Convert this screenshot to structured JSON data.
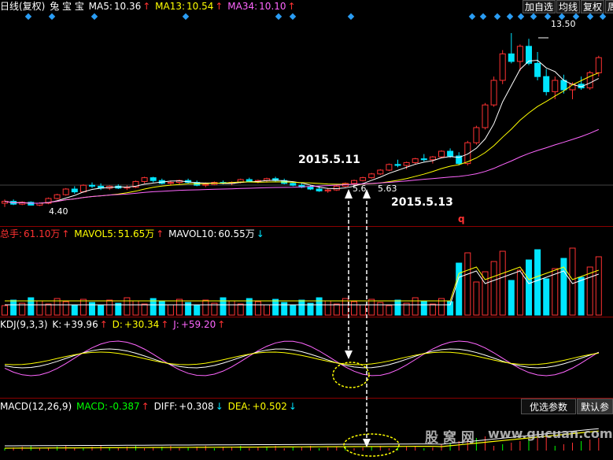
{
  "header": {
    "title": "日线(复权)",
    "stock_name": "兔 宝 宝",
    "ma5_label": "MA5:",
    "ma5_value": "10.36",
    "ma5_arrow": "↑",
    "ma13_label": "MA13:",
    "ma13_value": "10.54",
    "ma13_arrow": "↑",
    "ma34_label": "MA34:",
    "ma34_value": "10.10",
    "ma34_arrow": "↑"
  },
  "toolbar": {
    "add_watch": "加自选",
    "ma_line": "均线",
    "adjust": "复权",
    "more": "周"
  },
  "volume_header": {
    "total_label": "总手:",
    "total_value": "61.10万",
    "total_arrow": "↑",
    "mavol5_label": "MAVOL5:",
    "mavol5_value": "51.65万",
    "mavol5_arrow": "↑",
    "mavol10_label": "MAVOL10:",
    "mavol10_value": "60.55万",
    "mavol10_arrow": "↓"
  },
  "kdj_header": {
    "name": "KDJ(9,3,3)",
    "k_label": "K:",
    "k_value": "+39.96",
    "k_arrow": "↑",
    "d_label": "D:",
    "d_value": "+30.34",
    "d_arrow": "↑",
    "j_label": "J:",
    "j_value": "+59.20",
    "j_arrow": "↑"
  },
  "macd_header": {
    "name": "MACD(12,26,9)",
    "macd_label": "MACD:",
    "macd_value": "-0.387",
    "macd_arrow": "↑",
    "diff_label": "DIFF:",
    "diff_value": "+0.308",
    "diff_arrow": "↓",
    "dea_label": "DEA:",
    "dea_value": "+0.502",
    "dea_arrow": "↓"
  },
  "tabs": {
    "optimized": "优选参数",
    "default": "默认参"
  },
  "annotations": {
    "date1": "2015.5.11",
    "date2": "2015.5.13",
    "marker_q": "q"
  },
  "price_labels": {
    "high": "13.50",
    "low": "4.40",
    "mid1": "5.6",
    "mid2": "5.63"
  },
  "watermark": {
    "cn": "股 窝 网",
    "url": "www.gucuan.com"
  },
  "colors": {
    "up": "#ff3232",
    "down": "#00e5ff",
    "ma5": "#ffffff",
    "ma13": "#ffff00",
    "ma34": "#ff66ff",
    "grid": "#8b0000",
    "diamond": "#2a9df4",
    "k": "#ffffff",
    "d": "#ffff00",
    "j": "#ff66ff",
    "dashed_circle": "#ffff00"
  },
  "chart_data": {
    "type": "candlestick",
    "ylim": [
      4,
      14
    ],
    "series": [
      {
        "name": "MA5",
        "value": 10.36
      },
      {
        "name": "MA13",
        "value": 10.54
      },
      {
        "name": "MA34",
        "value": 10.1
      }
    ],
    "candles": [
      [
        4.5,
        4.7,
        4.3,
        4.6
      ],
      [
        4.6,
        4.7,
        4.4,
        4.45
      ],
      [
        4.45,
        4.6,
        4.4,
        4.55
      ],
      [
        4.55,
        4.6,
        4.38,
        4.4
      ],
      [
        4.4,
        4.55,
        4.35,
        4.5
      ],
      [
        4.5,
        4.8,
        4.45,
        4.75
      ],
      [
        4.75,
        5.0,
        4.7,
        4.95
      ],
      [
        4.95,
        5.3,
        4.9,
        5.25
      ],
      [
        5.25,
        5.4,
        5.0,
        5.1
      ],
      [
        5.1,
        5.5,
        5.05,
        5.45
      ],
      [
        5.45,
        5.6,
        5.3,
        5.4
      ],
      [
        5.4,
        5.55,
        5.2,
        5.3
      ],
      [
        5.3,
        5.45,
        5.2,
        5.4
      ],
      [
        5.4,
        5.5,
        5.25,
        5.3
      ],
      [
        5.3,
        5.45,
        5.2,
        5.35
      ],
      [
        5.35,
        5.7,
        5.3,
        5.65
      ],
      [
        5.65,
        5.9,
        5.55,
        5.85
      ],
      [
        5.85,
        5.9,
        5.6,
        5.7
      ],
      [
        5.7,
        5.8,
        5.5,
        5.55
      ],
      [
        5.55,
        5.7,
        5.45,
        5.6
      ],
      [
        5.6,
        5.75,
        5.5,
        5.7
      ],
      [
        5.7,
        5.8,
        5.55,
        5.6
      ],
      [
        5.6,
        5.7,
        5.4,
        5.45
      ],
      [
        5.45,
        5.6,
        5.35,
        5.5
      ],
      [
        5.5,
        5.65,
        5.45,
        5.6
      ],
      [
        5.6,
        5.7,
        5.5,
        5.55
      ],
      [
        5.55,
        5.65,
        5.45,
        5.6
      ],
      [
        5.6,
        5.8,
        5.55,
        5.75
      ],
      [
        5.75,
        5.85,
        5.6,
        5.65
      ],
      [
        5.65,
        5.75,
        5.55,
        5.7
      ],
      [
        5.7,
        5.85,
        5.6,
        5.8
      ],
      [
        5.8,
        5.9,
        5.65,
        5.7
      ],
      [
        5.7,
        5.8,
        5.5,
        5.55
      ],
      [
        5.55,
        5.65,
        5.4,
        5.45
      ],
      [
        5.45,
        5.55,
        5.3,
        5.35
      ],
      [
        5.35,
        5.45,
        5.2,
        5.25
      ],
      [
        5.25,
        5.4,
        5.1,
        5.15
      ],
      [
        5.15,
        5.3,
        5.05,
        5.2
      ],
      [
        5.2,
        5.45,
        5.15,
        5.4
      ],
      [
        5.4,
        5.6,
        5.35,
        5.55
      ],
      [
        5.55,
        5.75,
        5.5,
        5.7
      ],
      [
        5.7,
        5.9,
        5.65,
        5.85
      ],
      [
        5.85,
        6.1,
        5.8,
        6.05
      ],
      [
        6.05,
        6.3,
        6.0,
        6.25
      ],
      [
        6.25,
        6.6,
        6.2,
        6.55
      ],
      [
        6.55,
        6.8,
        6.4,
        6.5
      ],
      [
        6.5,
        6.7,
        6.3,
        6.65
      ],
      [
        6.65,
        6.9,
        6.55,
        6.85
      ],
      [
        6.85,
        7.1,
        6.7,
        6.8
      ],
      [
        6.8,
        7.0,
        6.6,
        6.95
      ],
      [
        6.95,
        7.3,
        6.9,
        7.25
      ],
      [
        7.25,
        7.4,
        6.9,
        7.0
      ],
      [
        7.0,
        7.2,
        6.5,
        6.6
      ],
      [
        6.6,
        7.8,
        6.5,
        7.7
      ],
      [
        7.7,
        8.6,
        7.6,
        8.5
      ],
      [
        8.5,
        9.8,
        8.4,
        9.7
      ],
      [
        9.7,
        11.2,
        9.6,
        11.0
      ],
      [
        11.0,
        12.6,
        10.8,
        12.4
      ],
      [
        12.4,
        13.5,
        11.9,
        12.0
      ],
      [
        12.0,
        12.9,
        11.5,
        12.8
      ],
      [
        12.8,
        13.2,
        11.8,
        11.9
      ],
      [
        11.9,
        12.5,
        11.0,
        11.2
      ],
      [
        11.2,
        11.6,
        10.2,
        10.4
      ],
      [
        10.4,
        11.2,
        10.0,
        11.0
      ],
      [
        11.0,
        11.3,
        10.3,
        10.5
      ],
      [
        10.5,
        10.9,
        10.0,
        10.8
      ],
      [
        10.8,
        11.2,
        10.5,
        10.6
      ],
      [
        10.6,
        11.5,
        10.5,
        11.4
      ],
      [
        11.4,
        12.3,
        11.2,
        12.2
      ]
    ]
  }
}
